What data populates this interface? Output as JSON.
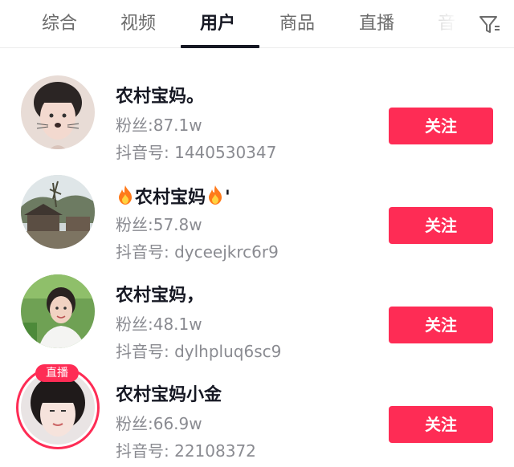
{
  "tabs": [
    {
      "label": "综合",
      "active": false
    },
    {
      "label": "视频",
      "active": false
    },
    {
      "label": "用户",
      "active": true
    },
    {
      "label": "商品",
      "active": false
    },
    {
      "label": "直播",
      "active": false
    },
    {
      "label": "音",
      "active": false
    }
  ],
  "filter": {
    "icon": "filter-icon"
  },
  "colors": {
    "accent": "#fe2c55",
    "text": "#161823",
    "muted": "#8a8b91"
  },
  "users": [
    {
      "name": "农村宝妈。",
      "fans": "粉丝:87.1w",
      "douyin_id": "抖音号: 1440530347",
      "follow_label": "关注",
      "live": false
    },
    {
      "name_prefix_icon": "fire-icon",
      "name": "农村宝妈",
      "name_suffix": "'",
      "name_suffix_icon": "fire-icon",
      "fans": "粉丝:57.8w",
      "douyin_id": "抖音号: dyceejkrc6r9",
      "follow_label": "关注",
      "live": false
    },
    {
      "name": "农村宝妈，",
      "fans": "粉丝:48.1w",
      "douyin_id": "抖音号: dylhpluq6sc9",
      "follow_label": "关注",
      "live": false
    },
    {
      "name": "农村宝妈小金",
      "fans": "粉丝:66.9w",
      "douyin_id": "抖音号: 22108372",
      "follow_label": "关注",
      "live": true,
      "live_label": "直播"
    }
  ]
}
